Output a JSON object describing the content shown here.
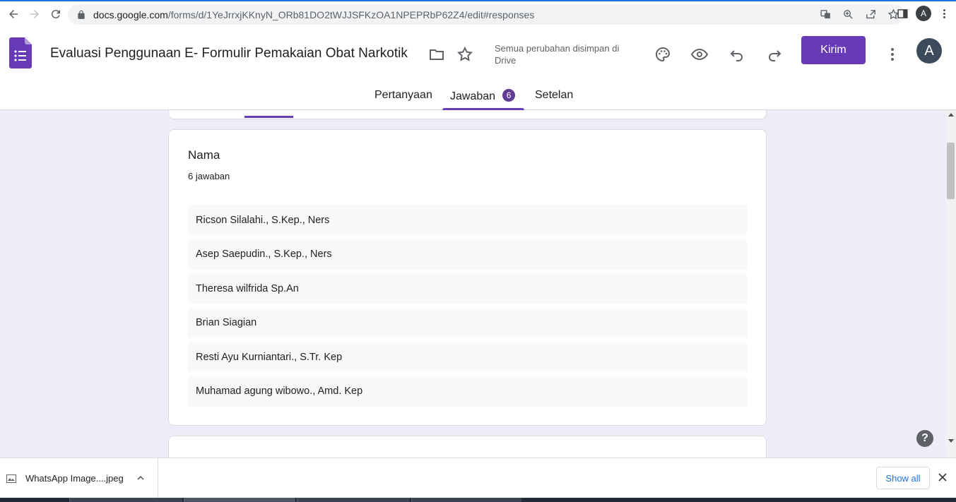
{
  "browser": {
    "url_host": "docs.google.com",
    "url_path": "/forms/d/1YeJrrxjKKnyN_ORb81DO2tWJJSFKzOA1NPEPRbP62Z4/edit#responses",
    "profile_initial": "A"
  },
  "header": {
    "form_title": "Evaluasi Penggunaan E- Formulir Pemakaian Obat Narkotik",
    "save_status": "Semua perubahan disimpan di Drive",
    "send_label": "Kirim",
    "avatar_initial": "A"
  },
  "tabs": {
    "questions": "Pertanyaan",
    "responses": "Jawaban",
    "responses_count": "6",
    "settings": "Setelan"
  },
  "question": {
    "title": "Nama",
    "response_count": "6 jawaban",
    "answers": [
      "Ricson Silalahi., S.Kep., Ners",
      "Asep Saepudin., S.Kep., Ners",
      "Theresa wilfrida Sp.An",
      "Brian Siagian",
      "Resti Ayu Kurniantari., S.Tr. Kep",
      "Muhamad agung wibowo., Amd. Kep"
    ]
  },
  "help": {
    "label": "?"
  },
  "downloads": {
    "file_name": "WhatsApp Image....jpeg",
    "show_all": "Show all"
  },
  "colors": {
    "accent": "#673ab7",
    "background": "#f0ebf8",
    "link": "#1a73e8"
  }
}
